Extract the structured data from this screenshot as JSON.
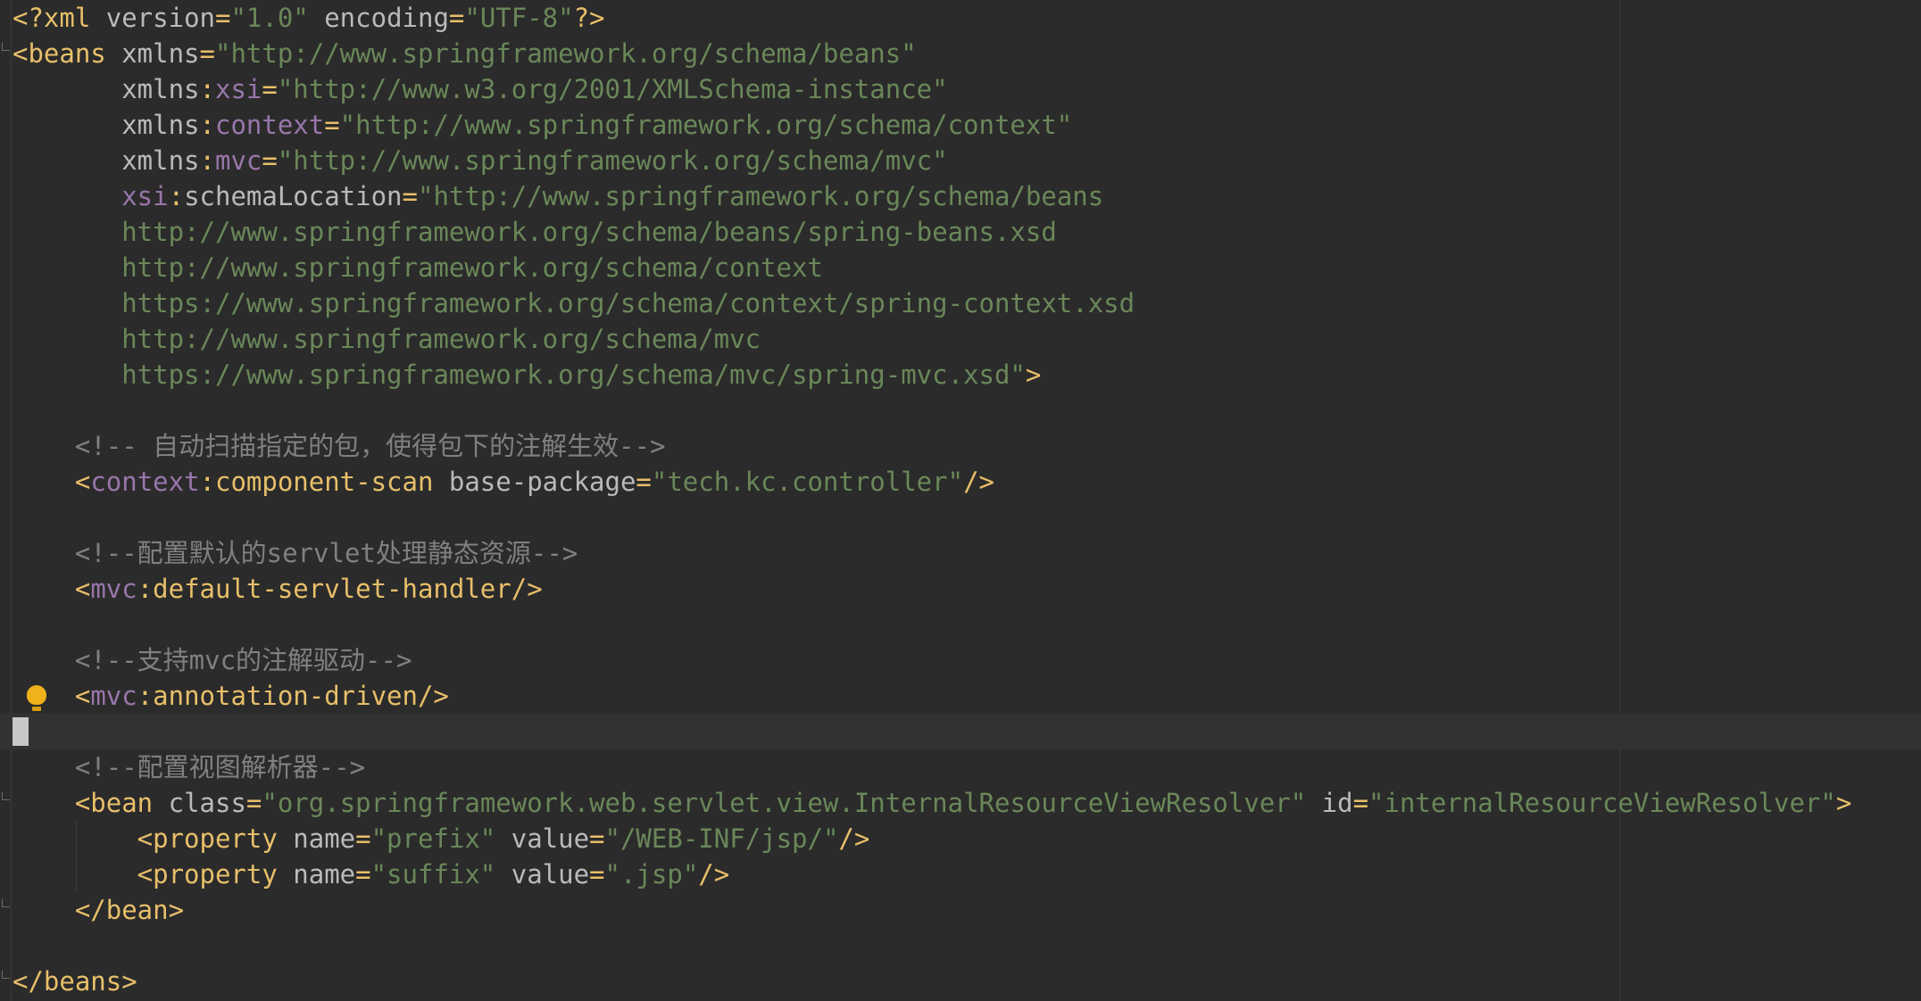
{
  "editor": {
    "file_type": "xml",
    "colors": {
      "background": "#2b2b2b",
      "tag": "#e8bf6a",
      "attribute": "#bababa",
      "namespace": "#9876aa",
      "string": "#6a8759",
      "comment": "#808080"
    },
    "lines": [
      [
        {
          "t": "pi",
          "v": "<?xml "
        },
        {
          "t": "attr",
          "v": "version"
        },
        {
          "t": "pi",
          "v": "="
        },
        {
          "t": "str",
          "v": "\"1.0\""
        },
        {
          "t": "attr",
          "v": " encoding"
        },
        {
          "t": "pi",
          "v": "="
        },
        {
          "t": "str",
          "v": "\"UTF-8\""
        },
        {
          "t": "pi",
          "v": "?>"
        }
      ],
      [
        {
          "t": "tag",
          "v": "<beans "
        },
        {
          "t": "attr",
          "v": "xmlns"
        },
        {
          "t": "pi",
          "v": "="
        },
        {
          "t": "str",
          "v": "\"http://www.springframework.org/schema/beans\""
        }
      ],
      [
        {
          "t": "attr",
          "v": "       xmlns"
        },
        {
          "t": "pi",
          "v": ":"
        },
        {
          "t": "ns",
          "v": "xsi"
        },
        {
          "t": "pi",
          "v": "="
        },
        {
          "t": "str",
          "v": "\"http://www.w3.org/2001/XMLSchema-instance\""
        }
      ],
      [
        {
          "t": "attr",
          "v": "       xmlns"
        },
        {
          "t": "pi",
          "v": ":"
        },
        {
          "t": "ns",
          "v": "context"
        },
        {
          "t": "pi",
          "v": "="
        },
        {
          "t": "str",
          "v": "\"http://www.springframework.org/schema/context\""
        }
      ],
      [
        {
          "t": "attr",
          "v": "       xmlns"
        },
        {
          "t": "pi",
          "v": ":"
        },
        {
          "t": "ns",
          "v": "mvc"
        },
        {
          "t": "pi",
          "v": "="
        },
        {
          "t": "str",
          "v": "\"http://www.springframework.org/schema/mvc\""
        }
      ],
      [
        {
          "t": "ns",
          "v": "       xsi"
        },
        {
          "t": "pi",
          "v": ":"
        },
        {
          "t": "attr",
          "v": "schemaLocation"
        },
        {
          "t": "pi",
          "v": "="
        },
        {
          "t": "str",
          "v": "\"http://www.springframework.org/schema/beans"
        }
      ],
      [
        {
          "t": "str",
          "v": "       http://www.springframework.org/schema/beans/spring-beans.xsd"
        }
      ],
      [
        {
          "t": "str",
          "v": "       http://www.springframework.org/schema/context"
        }
      ],
      [
        {
          "t": "str",
          "v": "       https://www.springframework.org/schema/context/spring-context.xsd"
        }
      ],
      [
        {
          "t": "str",
          "v": "       http://www.springframework.org/schema/mvc"
        }
      ],
      [
        {
          "t": "str",
          "v": "       https://www.springframework.org/schema/mvc/spring-mvc.xsd\""
        },
        {
          "t": "tag",
          "v": ">"
        }
      ],
      [],
      [
        {
          "t": "cmt",
          "v": "    <!-- 自动扫描指定的包，使得包下的注解生效-->"
        }
      ],
      [
        {
          "t": "tag",
          "v": "    <"
        },
        {
          "t": "ns",
          "v": "context"
        },
        {
          "t": "tag",
          "v": ":component-scan "
        },
        {
          "t": "attr",
          "v": "base-package"
        },
        {
          "t": "pi",
          "v": "="
        },
        {
          "t": "str",
          "v": "\"tech.kc.controller\""
        },
        {
          "t": "tag",
          "v": "/>"
        }
      ],
      [],
      [
        {
          "t": "cmt",
          "v": "    <!--配置默认的servlet处理静态资源-->"
        }
      ],
      [
        {
          "t": "tag",
          "v": "    <"
        },
        {
          "t": "ns",
          "v": "mvc"
        },
        {
          "t": "tag",
          "v": ":default-servlet-handler/>"
        }
      ],
      [],
      [
        {
          "t": "cmt",
          "v": "    <!--支持mvc的注解驱动-->"
        }
      ],
      [
        {
          "t": "tag",
          "v": "    <"
        },
        {
          "t": "ns",
          "v": "mvc"
        },
        {
          "t": "tag",
          "v": ":annotation-driven/>"
        }
      ],
      [],
      [
        {
          "t": "cmt",
          "v": "    <!--配置视图解析器-->"
        }
      ],
      [
        {
          "t": "tag",
          "v": "    <bean "
        },
        {
          "t": "attr",
          "v": "class"
        },
        {
          "t": "pi",
          "v": "="
        },
        {
          "t": "str",
          "v": "\"org.springframework.web.servlet.view.InternalResourceViewResolver\""
        },
        {
          "t": "attr",
          "v": " id"
        },
        {
          "t": "pi",
          "v": "="
        },
        {
          "t": "str",
          "v": "\"internalResourceViewResolver\""
        },
        {
          "t": "tag",
          "v": ">"
        }
      ],
      [
        {
          "t": "tag",
          "v": "        <property "
        },
        {
          "t": "attr",
          "v": "name"
        },
        {
          "t": "pi",
          "v": "="
        },
        {
          "t": "str",
          "v": "\"prefix\""
        },
        {
          "t": "attr",
          "v": " value"
        },
        {
          "t": "pi",
          "v": "="
        },
        {
          "t": "str",
          "v": "\"/WEB-INF/jsp/\""
        },
        {
          "t": "tag",
          "v": "/>"
        }
      ],
      [
        {
          "t": "tag",
          "v": "        <property "
        },
        {
          "t": "attr",
          "v": "name"
        },
        {
          "t": "pi",
          "v": "="
        },
        {
          "t": "str",
          "v": "\"suffix\""
        },
        {
          "t": "attr",
          "v": " value"
        },
        {
          "t": "pi",
          "v": "="
        },
        {
          "t": "str",
          "v": "\".jsp\""
        },
        {
          "t": "tag",
          "v": "/>"
        }
      ],
      [
        {
          "t": "tag",
          "v": "    </bean>"
        }
      ],
      [],
      [
        {
          "t": "tag",
          "v": "</beans>"
        }
      ]
    ]
  }
}
